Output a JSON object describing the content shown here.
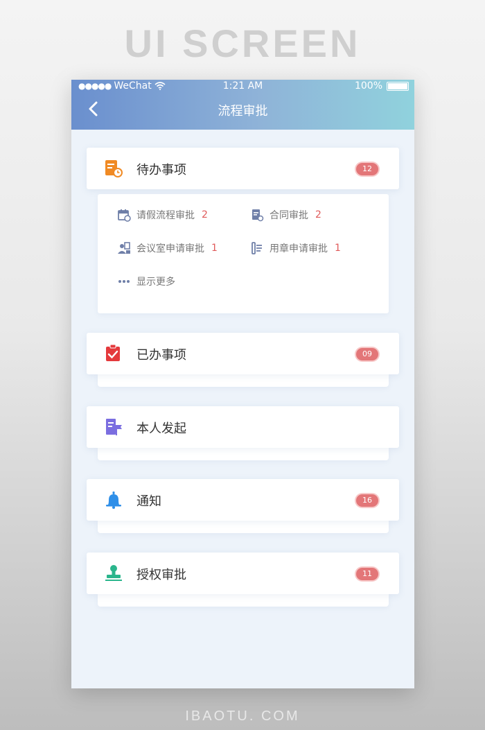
{
  "poster": {
    "heading": "UI SCREEN",
    "footer": "IBAOTU. COM"
  },
  "status_bar": {
    "carrier": "WeChat",
    "time": "1:21 AM",
    "battery": "100%"
  },
  "nav": {
    "title": "流程审批"
  },
  "sections": [
    {
      "title": "待办事项",
      "badge": "12",
      "icon": "task-clock-icon",
      "color": "#f08a24"
    },
    {
      "title": "已办事项",
      "badge": "09",
      "icon": "clipboard-check-icon",
      "color": "#e4393c"
    },
    {
      "title": "本人发起",
      "badge": "",
      "icon": "document-flag-icon",
      "color": "#7b6ee0"
    },
    {
      "title": "通知",
      "badge": "16",
      "icon": "bell-icon",
      "color": "#2f8fe8"
    },
    {
      "title": "授权审批",
      "badge": "11",
      "icon": "stamp-icon",
      "color": "#2ab58c"
    }
  ],
  "pending_items": [
    {
      "label": "请假流程审批",
      "count": "2",
      "icon": "calendar-icon"
    },
    {
      "label": "合同审批",
      "count": "2",
      "icon": "contract-icon"
    },
    {
      "label": "会议室申请审批",
      "count": "1",
      "icon": "meeting-room-icon"
    },
    {
      "label": "用章申请审批",
      "count": "1",
      "icon": "seal-icon"
    }
  ],
  "show_more": "显示更多",
  "colors": {
    "badge": "#e37678",
    "header_start": "#6a8fce",
    "header_end": "#90d2dd",
    "sub_icon": "#6f7fa8"
  }
}
